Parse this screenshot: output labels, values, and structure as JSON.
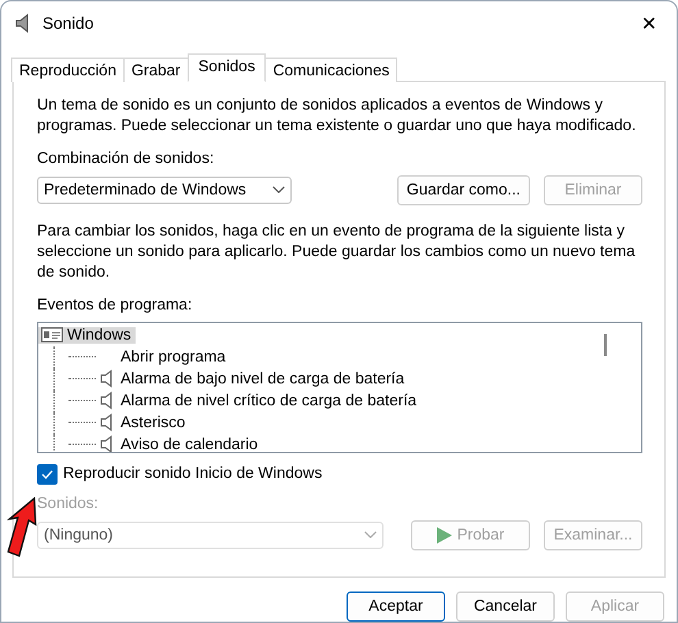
{
  "window": {
    "title": "Sonido",
    "close": "✕"
  },
  "tabs": [
    {
      "label": "Reproducción",
      "selected": false
    },
    {
      "label": "Grabar",
      "selected": false
    },
    {
      "label": "Sonidos",
      "selected": true
    },
    {
      "label": "Comunicaciones",
      "selected": false
    }
  ],
  "intro": "Un tema de sonido es un conjunto de sonidos aplicados a eventos de Windows y programas. Puede seleccionar un tema existente o guardar uno que haya modificado.",
  "scheme": {
    "label": "Combinación de sonidos:",
    "value": "Predeterminado de Windows",
    "buttons": [
      {
        "label": "Guardar como...",
        "disabled": false
      },
      {
        "label": "Eliminar",
        "disabled": true
      }
    ]
  },
  "help": "Para cambiar los sonidos, haga clic en un evento de programa de la siguiente lista y seleccione un sonido para aplicarlo. Puede guardar los cambios como un nuevo tema de sonido.",
  "events": {
    "label": "Eventos de programa:",
    "tree": [
      {
        "label": "Windows",
        "selected": true,
        "children": [
          {
            "label": "Abrir programa",
            "has_sound": false
          },
          {
            "label": "Alarma de bajo nivel de carga de batería",
            "has_sound": true
          },
          {
            "label": "Alarma de nivel crítico de carga de batería",
            "has_sound": true
          },
          {
            "label": "Asterisco",
            "has_sound": true
          },
          {
            "label": "Aviso de calendario",
            "has_sound": true
          }
        ]
      }
    ]
  },
  "startup": {
    "label": "Reproducir sonido Inicio de Windows",
    "checked": true
  },
  "sounds": {
    "label": "Sonidos:",
    "value": "(Ninguno)",
    "disabled": true,
    "test": "Probar",
    "browse": "Examinar..."
  },
  "annotation": {
    "kind": "arrow"
  },
  "footer": [
    {
      "label": "Aceptar",
      "default": true,
      "disabled": false
    },
    {
      "label": "Cancelar",
      "default": false,
      "disabled": false
    },
    {
      "label": "Aplicar",
      "default": false,
      "disabled": true
    }
  ]
}
